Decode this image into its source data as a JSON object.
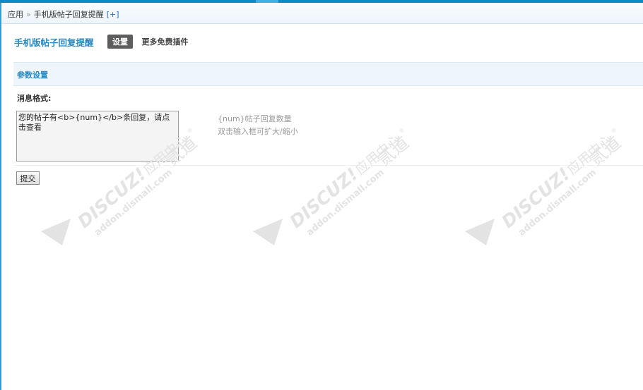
{
  "breadcrumb": {
    "root": "应用",
    "separator": "»",
    "current": "手机版帖子回复提醒",
    "add_label": "[+]"
  },
  "plugin": {
    "title": "手机版帖子回复提醒",
    "tabs": [
      {
        "label": "设置",
        "active": true
      },
      {
        "label": "更多免费插件",
        "active": false
      }
    ]
  },
  "section": {
    "title": "参数设置"
  },
  "form": {
    "message_format_label": "消息格式:",
    "message_format_value": "您的帖子有<b>{num}</b>条回复，请点击查看",
    "tips": [
      "{num}帖子回复数量",
      "双击输入框可扩大/缩小"
    ],
    "submit_label": "提交"
  },
  "watermark": {
    "brand": "DISCUZ!",
    "center": "应用中心",
    "site": "addon.dismall.com",
    "partner": "贰道",
    "mark": "®"
  },
  "colors": {
    "accent": "#2a88c1",
    "top_strip": "#0b8ac9",
    "section_bg": "#eef5fb"
  }
}
